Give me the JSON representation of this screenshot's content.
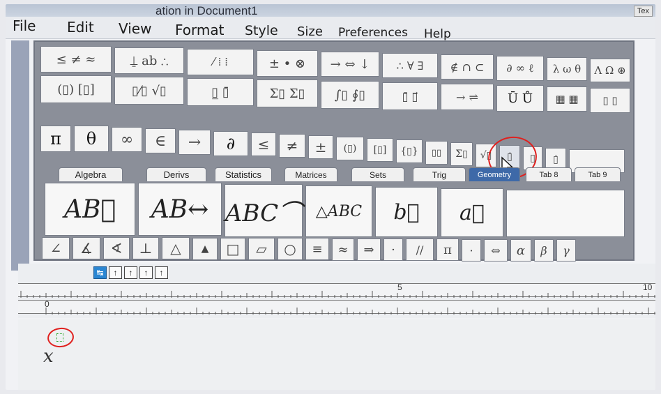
{
  "window": {
    "title": "ation in Document1",
    "right_hint": "Tex"
  },
  "menu": [
    "File",
    "Edit",
    "View",
    "Format",
    "Style",
    "Size",
    "Preferences",
    "Help"
  ],
  "toolbar_row1": [
    "≤ ≠ ≈",
    "⍊ ab ∴",
    "⁄ ⁞ ⁞",
    "± • ⊗",
    "→ ⇔ ↓",
    "∴ ∀ ∃",
    "∉ ∩ ⊂",
    "∂ ∞ ℓ",
    "λ ω θ",
    "Λ Ω ⊛"
  ],
  "toolbar_row2": [
    "(▯) [▯]",
    "▯⁄▯ √▯",
    "▯̲ ▯̄",
    "Σ▯ Σ▯",
    "∫▯ ∮▯",
    "▯̄ ▯⃗",
    "→ ⇌",
    "Ū Ů",
    "▦ ▦",
    "▯ ▯"
  ],
  "toolbar_row3": [
    "π",
    "θ",
    "∞",
    "∈",
    "→",
    "∂",
    "≤",
    "≠",
    "±",
    "(▯)",
    "[▯]",
    "{▯}",
    "▯▯",
    "Σ▯",
    "√▯",
    "▯̇",
    "▯",
    "▯̇"
  ],
  "tabs": [
    "Algebra",
    "Derivs",
    "Statistics",
    "Matrices",
    "Sets",
    "Trig",
    "Geometry",
    "Tab 8",
    "Tab 9"
  ],
  "active_tab": "Geometry",
  "templates": [
    "AB⃗",
    "AB↔",
    "ABC⌒",
    "△ABC",
    "b⃗",
    "a⃗"
  ],
  "geometry_row": [
    "∠",
    "∡",
    "∢",
    "⊥",
    "△",
    "▲",
    "□",
    "▱",
    "○",
    "≡",
    "≈",
    "⇒",
    "·",
    "//",
    "π",
    "·",
    "⇔",
    "α",
    "β",
    "γ"
  ],
  "tab_stops": [
    "↹",
    "↑",
    "↑",
    "↑",
    "↑"
  ],
  "ruler": {
    "top_marks": [
      "5",
      "10"
    ],
    "bottom_mark": "0"
  },
  "document": {
    "variable": "x"
  },
  "colors": {
    "annotation": "#e0201e",
    "active_tab": "#3e69a8"
  }
}
